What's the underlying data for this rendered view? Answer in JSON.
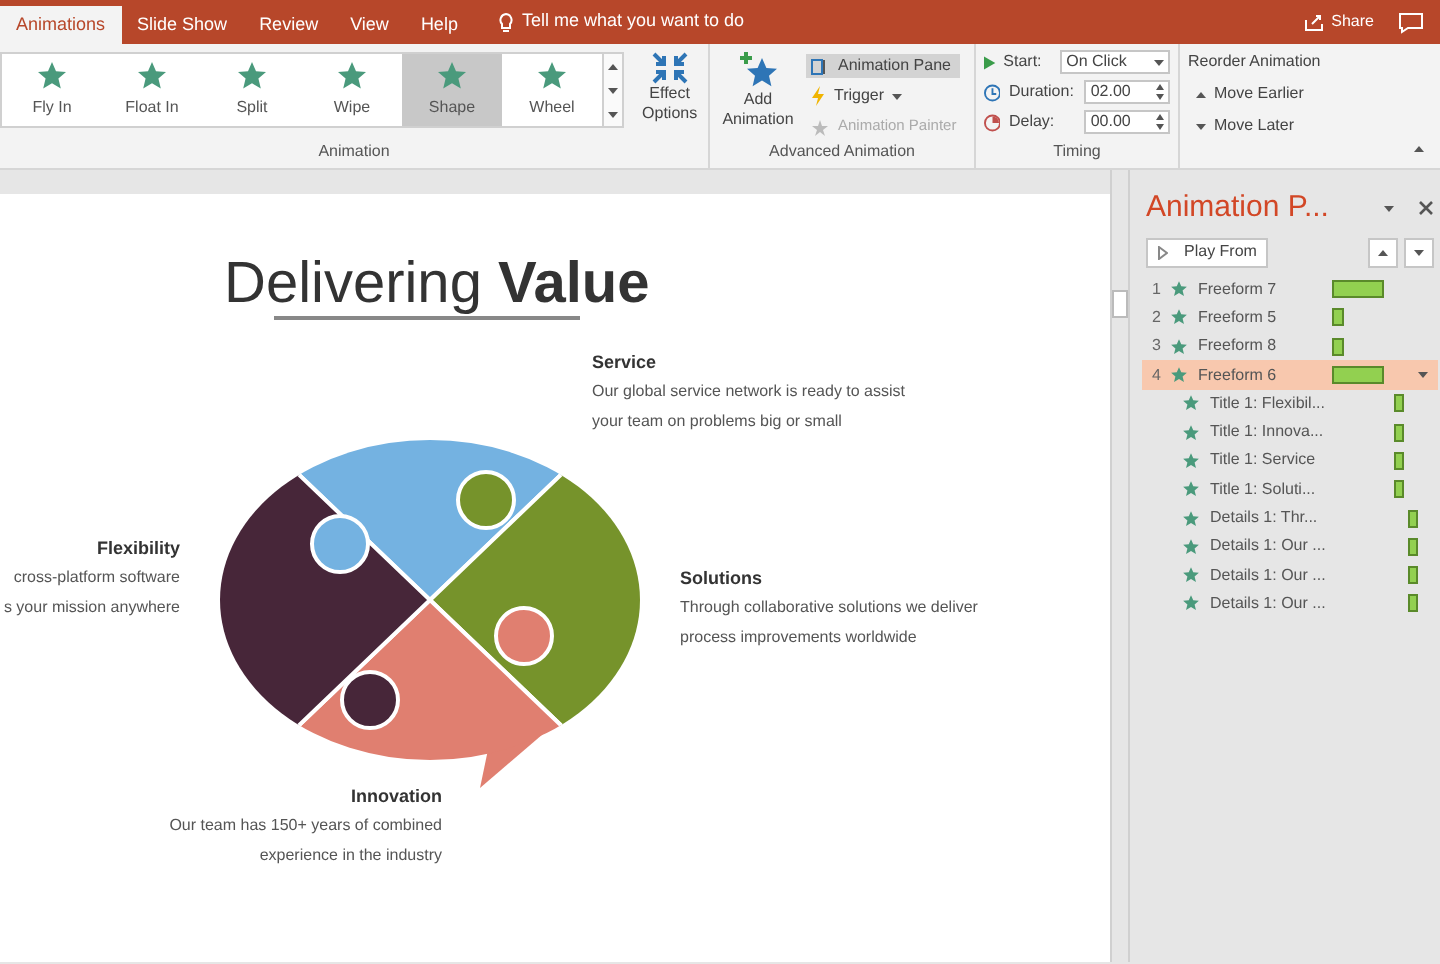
{
  "ribbon_tabs": [
    {
      "label": "Animations",
      "selected": true
    },
    {
      "label": "Slide Show",
      "selected": false
    },
    {
      "label": "Review",
      "selected": false
    },
    {
      "label": "View",
      "selected": false
    },
    {
      "label": "Help",
      "selected": false
    }
  ],
  "tell_me": "Tell me what you want to do",
  "share": "Share",
  "animation_group": {
    "label": "Animation",
    "effects": [
      {
        "label": "Fly In",
        "selected": false
      },
      {
        "label": "Float In",
        "selected": false
      },
      {
        "label": "Split",
        "selected": false
      },
      {
        "label": "Wipe",
        "selected": false
      },
      {
        "label": "Shape",
        "selected": true
      },
      {
        "label": "Wheel",
        "selected": false
      }
    ],
    "effect_options": [
      "Effect",
      "Options"
    ]
  },
  "advanced_group": {
    "label": "Advanced Animation",
    "add_animation": [
      "Add",
      "Animation"
    ],
    "animation_pane": "Animation Pane",
    "trigger": "Trigger",
    "animation_painter": {
      "label": "Animation Painter",
      "disabled": true
    }
  },
  "timing_group": {
    "label": "Timing",
    "start_label": "Start:",
    "start_value": "On Click",
    "duration_label": "Duration:",
    "duration_value": "02.00",
    "delay_label": "Delay:",
    "delay_value": "00.00"
  },
  "reorder": {
    "title": "Reorder Animation",
    "move_earlier": "Move Earlier",
    "move_later": "Move Later"
  },
  "slide": {
    "title": "Delivering **Value**",
    "blocks": [
      {
        "kind": "right",
        "heading": "Service",
        "lines": [
          "Our global service network is ready to assist",
          "your team on problems big or small"
        ]
      },
      {
        "kind": "left",
        "heading": "Flexibility",
        "lines": [
          "cross-platform software",
          "s your mission anywhere"
        ]
      },
      {
        "kind": "right",
        "heading": "Solutions",
        "lines": [
          "Through collaborative solutions we deliver",
          "process improvements worldwide"
        ]
      },
      {
        "kind": "left",
        "heading": "Innovation",
        "lines": [
          "Our team has 150+ years of combined",
          "experience in the industry"
        ]
      }
    ]
  },
  "animation_pane": {
    "title": "Animation P...",
    "play_from": "Play From",
    "items": [
      {
        "number": "1",
        "label": "Freeform 7",
        "kind": "full",
        "selected": false
      },
      {
        "number": "2",
        "label": "Freeform 5",
        "kind": "start",
        "selected": false
      },
      {
        "number": "3",
        "label": "Freeform 8",
        "kind": "start",
        "selected": false
      },
      {
        "number": "4",
        "label": "Freeform 6",
        "kind": "full",
        "selected": true,
        "children": [
          {
            "label": "Title 1: Flexibil...",
            "kind": "mid"
          },
          {
            "label": "Title 1: Innova...",
            "kind": "mid"
          },
          {
            "label": "Title 1: Service",
            "kind": "mid"
          },
          {
            "label": "Title 1: Soluti...",
            "kind": "mid"
          },
          {
            "label": "Details 1: Thr...",
            "kind": "end"
          },
          {
            "label": "Details 1: Our ...",
            "kind": "end"
          },
          {
            "label": "Details 1: Our ...",
            "kind": "end"
          },
          {
            "label": "Details 1: Our ...",
            "kind": "end"
          }
        ]
      }
    ]
  }
}
